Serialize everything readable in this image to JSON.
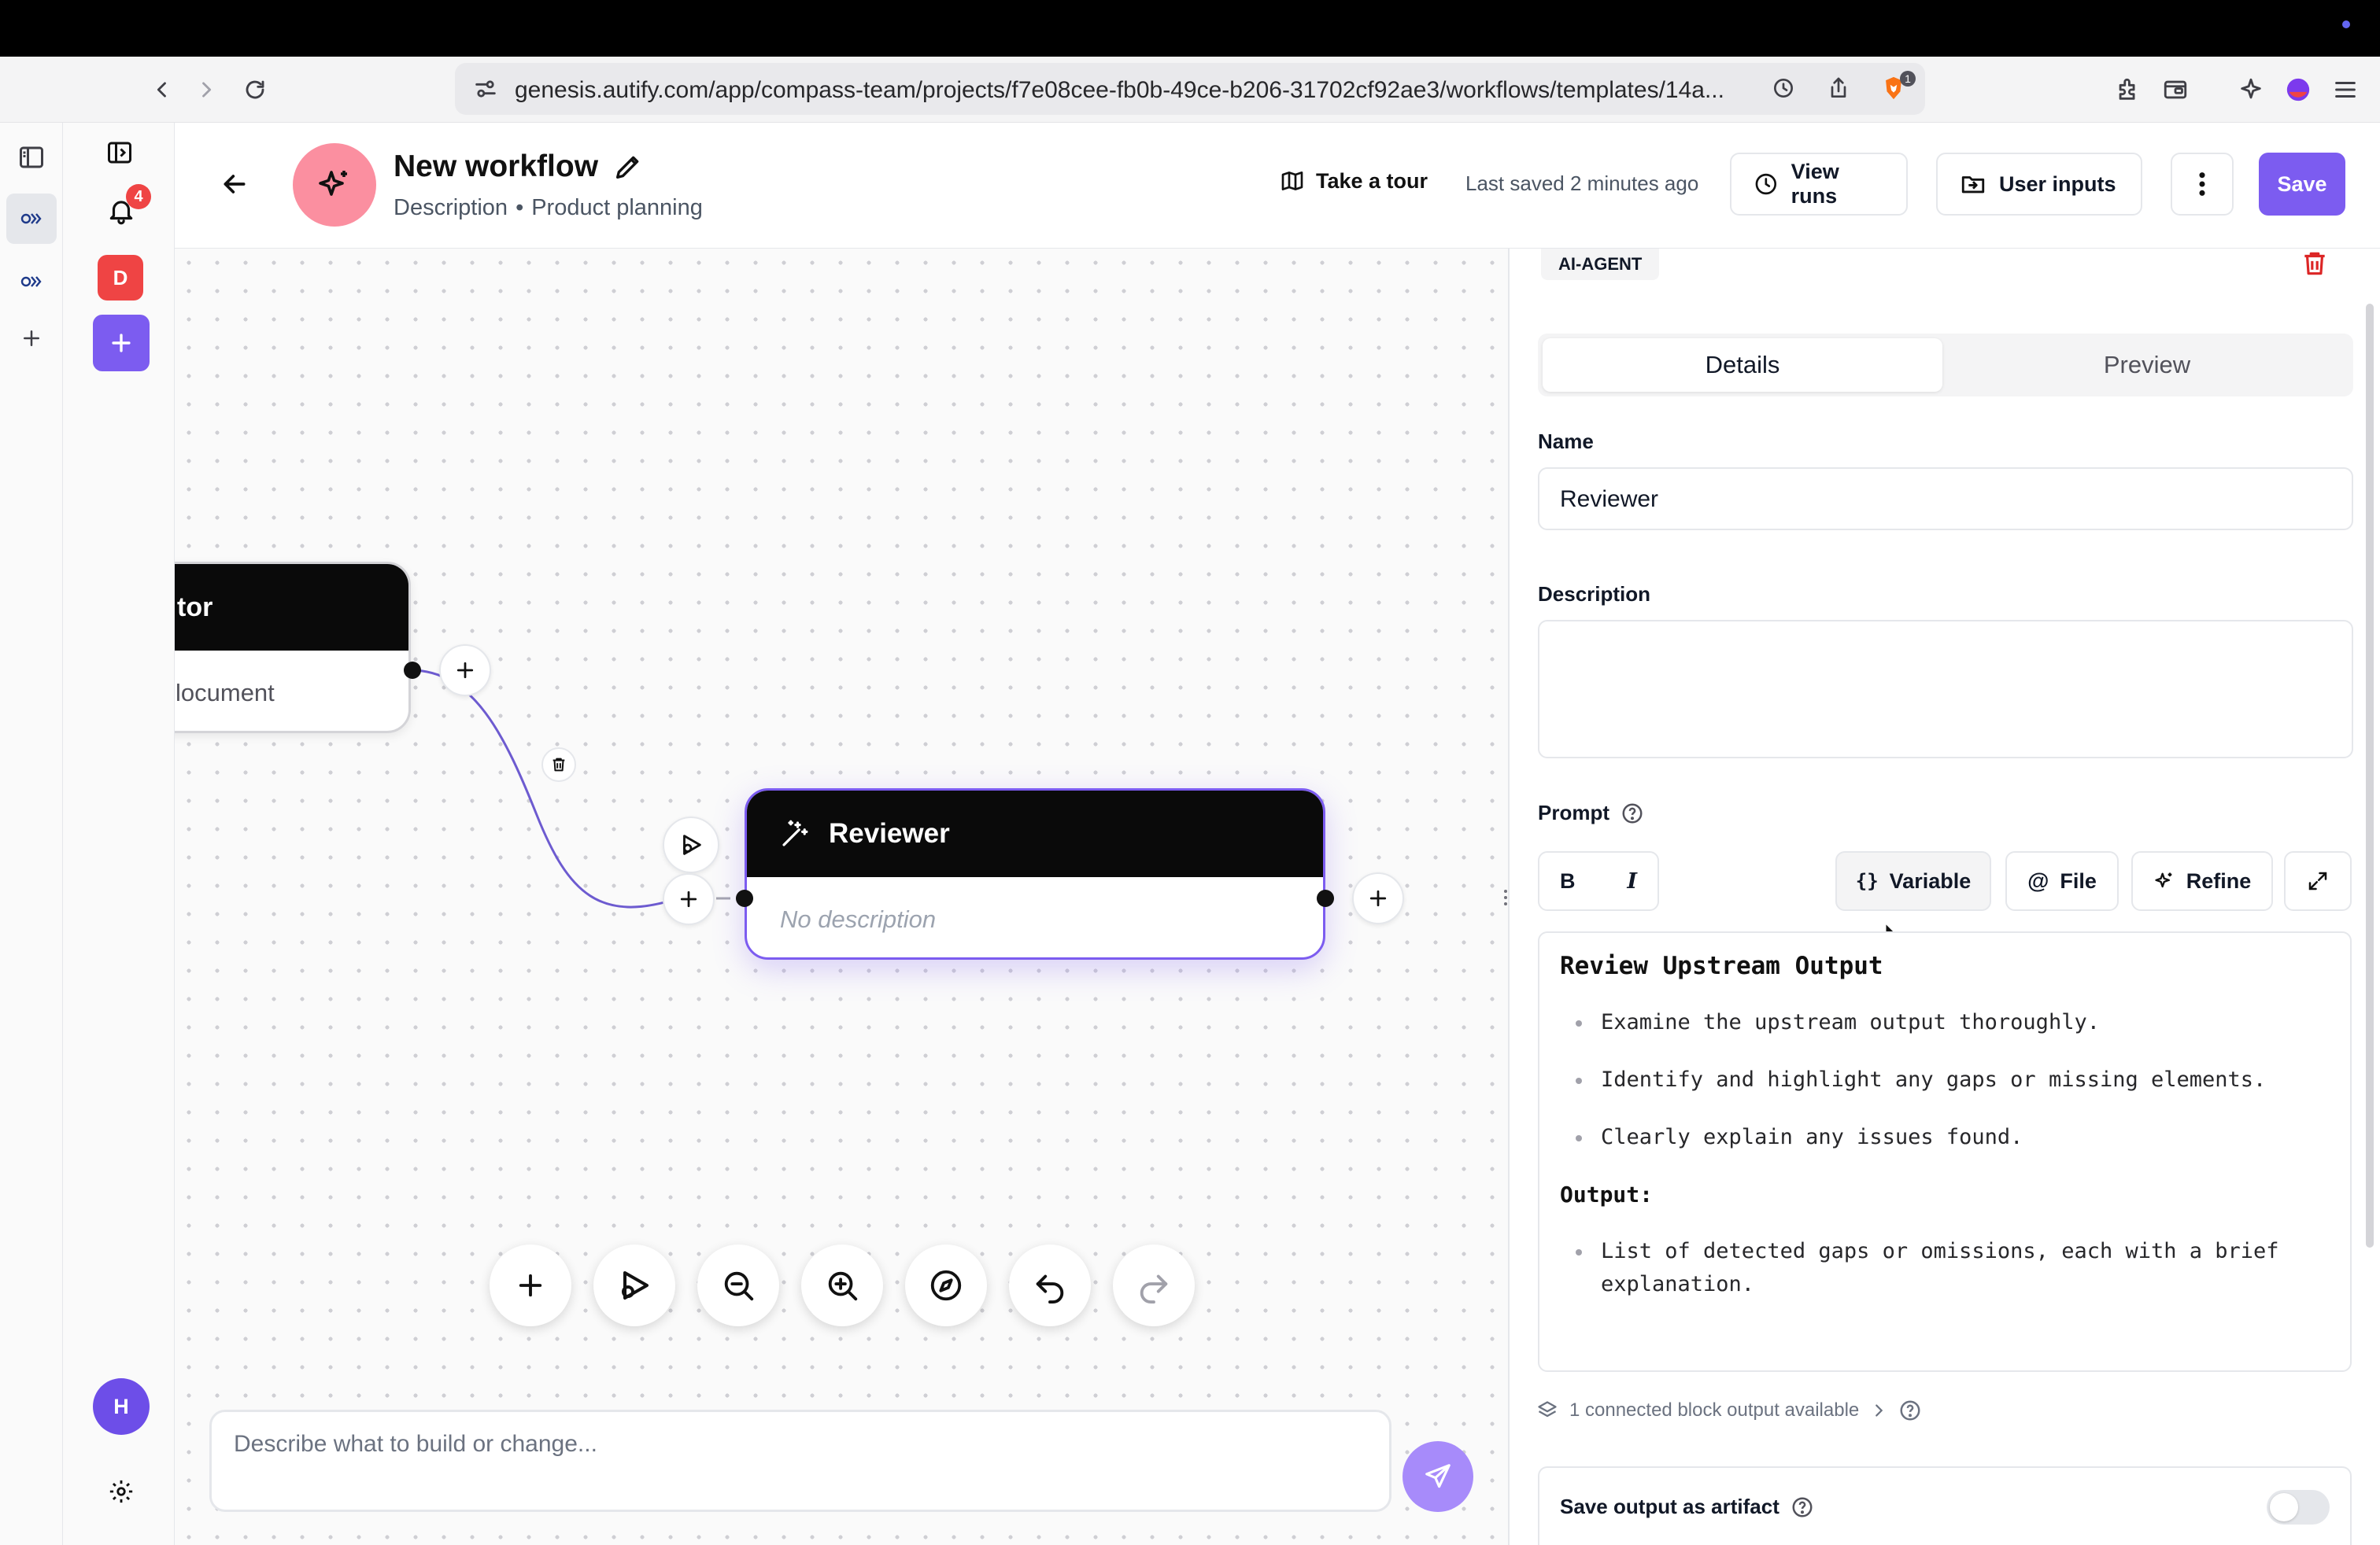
{
  "browser": {
    "url": "genesis.autify.com/app/compass-team/projects/f7e08cee-fb0b-49ce-b206-31702cf92ae3/workflows/templates/14a...",
    "extension_badge": "1"
  },
  "sidebar": {
    "notification_count": "4",
    "project_initial": "D",
    "user_initial": "H"
  },
  "header": {
    "title": "New workflow",
    "description": "Description",
    "separator": "•",
    "category": "Product planning",
    "tour_label": "Take a tour",
    "last_saved": "Last saved 2 minutes ago",
    "view_runs_label": "View runs",
    "user_inputs_label": "User inputs",
    "save_label": "Save"
  },
  "canvas": {
    "prev_node": {
      "title": "tor",
      "body": "locument"
    },
    "reviewer_node": {
      "title": "Reviewer",
      "body": "No description"
    },
    "chat_placeholder": "Describe what to build or change..."
  },
  "panel": {
    "type_badge": "AI-AGENT",
    "tabs": [
      "Details",
      "Preview"
    ],
    "active_tab": "Details",
    "name_label": "Name",
    "name_value": "Reviewer",
    "description_label": "Description",
    "description_value": "",
    "prompt_label": "Prompt",
    "toolbar": {
      "bold": "B",
      "italic": "I",
      "variable_label": "Variable",
      "variable_glyph": "{}",
      "file_label": "File",
      "file_glyph": "@",
      "refine_label": "Refine"
    },
    "prompt": {
      "heading": "Review Upstream Output",
      "bullets": [
        "Examine the upstream output thoroughly.",
        "Identify and highlight any gaps or missing elements.",
        "Clearly explain any issues found."
      ],
      "output_label": "Output:",
      "output_line1": "List of detected gaps or omissions, each with a brief",
      "output_line2": "explanation."
    },
    "connected_info": "1 connected block output available",
    "save_artifact_label": "Save output as artifact",
    "save_artifact_enabled": false
  },
  "colors": {
    "accent": "#7c5cf0",
    "danger": "#ef4444",
    "avatar": "#fb8fa0"
  }
}
